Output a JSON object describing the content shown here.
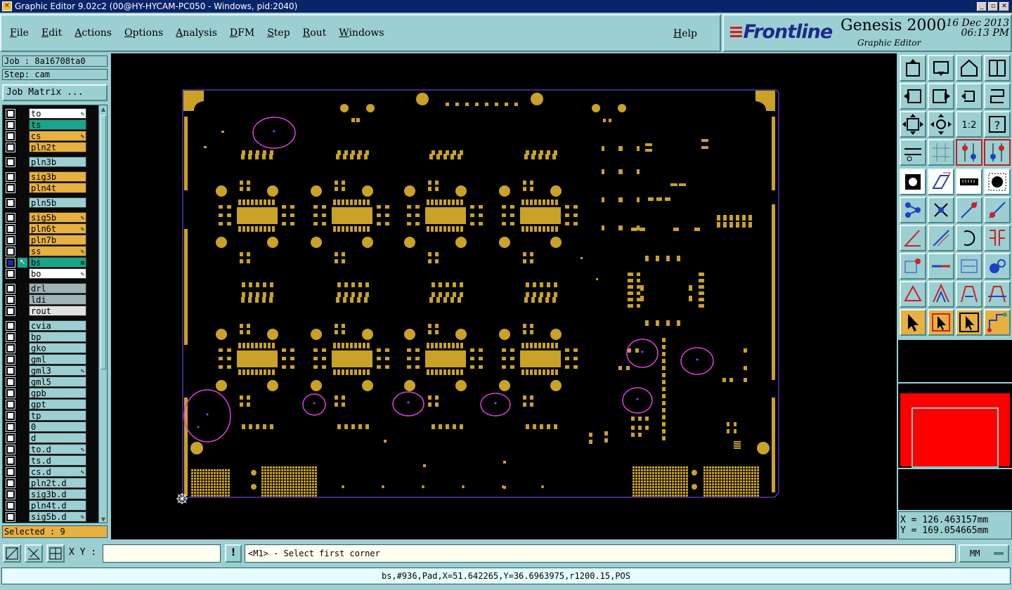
{
  "window": {
    "title": "Graphic Editor 9.02c2 (00@HY-HYCAM-PC050 - Windows, pid:2040)"
  },
  "menu": {
    "items": [
      "File",
      "Edit",
      "Actions",
      "Options",
      "Analysis",
      "DFM",
      "Step",
      "Rout",
      "Windows"
    ],
    "help": "Help"
  },
  "brand": {
    "logo": "Frontline",
    "product": "Genesis 2000",
    "subtitle": "Graphic Editor",
    "date": "16 Dec 2013",
    "time": "06:13 PM"
  },
  "job": {
    "job_label": "Job : 8a16708ta0",
    "step_label": "Step: cam",
    "matrix_button": "Job Matrix ..."
  },
  "layers": [
    {
      "name": "to",
      "color": "#ffffff",
      "mark": "✎",
      "group": 0
    },
    {
      "name": "ts",
      "color": "#1aa58a",
      "mark": "",
      "group": 0
    },
    {
      "name": "cs",
      "color": "#e8b040",
      "mark": "✎",
      "group": 0
    },
    {
      "name": "pln2t",
      "color": "#e8b040",
      "mark": "",
      "group": 0
    },
    {
      "name": "pln3b",
      "color": "#9ccfd2",
      "mark": "",
      "group": 1
    },
    {
      "name": "sig3b",
      "color": "#e8b040",
      "mark": "",
      "group": 2
    },
    {
      "name": "pln4t",
      "color": "#e8b040",
      "mark": "",
      "group": 2
    },
    {
      "name": "pln5b",
      "color": "#9ccfd2",
      "mark": "",
      "group": 3
    },
    {
      "name": "sig5b",
      "color": "#e8b040",
      "mark": "✎",
      "group": 4
    },
    {
      "name": "pln6t",
      "color": "#e8b040",
      "mark": "✎",
      "group": 4
    },
    {
      "name": "pln7b",
      "color": "#e8b040",
      "mark": "",
      "group": 4
    },
    {
      "name": "ss",
      "color": "#e8b040",
      "mark": "✎",
      "group": 4
    },
    {
      "name": "bs",
      "color": "#1aa58a",
      "mark": "⊞",
      "group": 4,
      "work": true
    },
    {
      "name": "bo",
      "color": "#ffffff",
      "mark": "✎",
      "group": 4
    },
    {
      "name": "drl",
      "color": "#a0b4b8",
      "mark": "",
      "group": 5
    },
    {
      "name": "ldi",
      "color": "#a0b4b8",
      "mark": "",
      "group": 5
    },
    {
      "name": "rout",
      "color": "#e0e0e0",
      "mark": "",
      "group": 5
    },
    {
      "name": "cvia",
      "color": "#9ccfd2",
      "mark": "",
      "group": 6
    },
    {
      "name": "bp",
      "color": "#9ccfd2",
      "mark": "",
      "group": 6
    },
    {
      "name": "gko",
      "color": "#9ccfd2",
      "mark": "",
      "group": 6
    },
    {
      "name": "gml",
      "color": "#9ccfd2",
      "mark": "",
      "group": 6
    },
    {
      "name": "gml3",
      "color": "#9ccfd2",
      "mark": "✎",
      "group": 6
    },
    {
      "name": "gml5",
      "color": "#9ccfd2",
      "mark": "",
      "group": 6
    },
    {
      "name": "gpb",
      "color": "#9ccfd2",
      "mark": "",
      "group": 6
    },
    {
      "name": "gpt",
      "color": "#9ccfd2",
      "mark": "",
      "group": 6
    },
    {
      "name": "tp",
      "color": "#9ccfd2",
      "mark": "",
      "group": 6
    },
    {
      "name": "0",
      "color": "#9ccfd2",
      "mark": "",
      "group": 6
    },
    {
      "name": "d",
      "color": "#9ccfd2",
      "mark": "",
      "group": 6
    },
    {
      "name": "to.d",
      "color": "#9ccfd2",
      "mark": "✎",
      "group": 6
    },
    {
      "name": "ts.d",
      "color": "#9ccfd2",
      "mark": "",
      "group": 6
    },
    {
      "name": "cs.d",
      "color": "#9ccfd2",
      "mark": "✎",
      "group": 6
    },
    {
      "name": "pln2t.d",
      "color": "#9ccfd2",
      "mark": "",
      "group": 6
    },
    {
      "name": "sig3b.d",
      "color": "#9ccfd2",
      "mark": "",
      "group": 6
    },
    {
      "name": "pln4t.d",
      "color": "#9ccfd2",
      "mark": "",
      "group": 6
    },
    {
      "name": "sig5b.d",
      "color": "#9ccfd2",
      "mark": "✎",
      "group": 6
    }
  ],
  "selected": "Selected : 9",
  "coords": {
    "x": "X = 126.463157mm",
    "y": "Y = 169.054665mm"
  },
  "bottom": {
    "xy_label": "X Y :",
    "xy_value": "",
    "prompt": "<M1> - Select first corner",
    "units": "MM",
    "excl": "!"
  },
  "status": "bs,#936,Pad,X=51.642265,Y=36.6963975,r1200.15,POS",
  "colors": {
    "pad": "#c9a227",
    "outline": "#8a4dff",
    "highlight": "#e040e0",
    "bg": "#9ccfd2"
  }
}
